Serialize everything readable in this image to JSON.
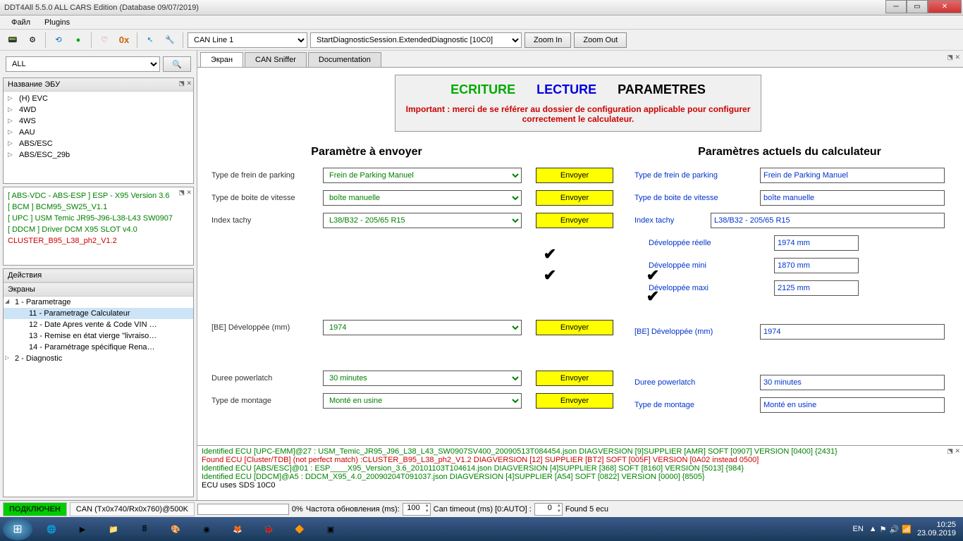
{
  "title": "DDT4All 5.5.0 ALL CARS Edition (Database 09/07/2019)",
  "menu": {
    "file": "Файл",
    "plugins": "Plugins"
  },
  "toolbar": {
    "connection_combo": "CAN Line 1",
    "session_combo": "StartDiagnosticSession.ExtendedDiagnostic [10C0]",
    "zoom_in": "Zoom In",
    "zoom_out": "Zoom Out"
  },
  "left": {
    "filter_all": "ALL",
    "ecu_name_header": "Название ЭБУ",
    "ecu_types": [
      "(H) EVC",
      "4WD",
      "4WS",
      "AAU",
      "ABS/ESC",
      "ABS/ESC_29b"
    ],
    "ecu_detected": [
      "[ ABS-VDC - ABS-ESP ] ESP - X95 Version 3.6",
      "[ BCM ] BCM95_SW25_V1.1",
      "[ UPC ] USM Temic JR95-J96-L38-L43 SW0907",
      "[ DDCM ] Driver DCM X95 SLOT v4.0",
      "CLUSTER_B95_L38_ph2_V1.2"
    ],
    "actions_header": "Действия",
    "screens_header": "Экраны",
    "tree_root": "1 - Parametrage",
    "tree_items": [
      "11 - Parametrage Calculateur",
      "12 - Date Apres vente & Code VIN …",
      "13 - Remise en état vierge \"livraiso…",
      "14 - Paramétrage spécifique Rena…"
    ],
    "tree_diag": "2 - Diagnostic"
  },
  "tabs": {
    "screen": "Экран",
    "sniffer": "CAN Sniffer",
    "docs": "Documentation"
  },
  "header": {
    "ecriture": "ECRITURE",
    "lecture": "LECTURE",
    "parametres": "PARAMETRES",
    "warning": "Important : merci de se référer au dossier de configuration applicable pour configurer correctement le calculateur."
  },
  "params_send_title": "Paramètre à envoyer",
  "params_actual_title": "Paramètres actuels du calculateur",
  "send_btn": "Envoyer",
  "rows": {
    "parking_label": "Type de frein de parking",
    "parking_value": "Frein de Parking Manuel",
    "gearbox_label": "Type de boite de vitesse",
    "gearbox_value": "boîte manuelle",
    "tachy_label": "Index tachy",
    "tachy_value": "L38/B32 - 205/65 R15",
    "dev_reelle_label": "Développée réelle",
    "dev_reelle_value": "1974 mm",
    "dev_mini_label": "Développée mini",
    "dev_mini_value": "1870 mm",
    "dev_maxi_label": "Développée maxi",
    "dev_maxi_value": "2125 mm",
    "be_dev_label": "[BE] Développée (mm)",
    "be_dev_value": "1974",
    "powerlatch_label": "Duree powerlatch",
    "powerlatch_value": "30 minutes",
    "montage_label": "Type de montage",
    "montage_value": "Monté en usine"
  },
  "log": [
    "Identified ECU [UPC-EMM]@27 : USM_Temic_JR95_J96_L38_L43_SW0907SV400_20090513T084454.json DIAGVERSION [9]SUPPLIER [AMR] SOFT [0907] VERSION [0400]  {2431}",
    "Found ECU [Cluster/TDB]  (not perfect match)  :CLUSTER_B95_L38_ph2_V1.2 DIAGVERSION [12] SUPPLIER [BT2] SOFT [005F] VERSION [0A02 instead 0500]",
    "Identified ECU [ABS/ESC]@01 : ESP____X95_Version_3.6_20101103T104614.json DIAGVERSION [4]SUPPLIER [368] SOFT [8160] VERSION [5013]  {984}",
    "Identified ECU [DDCM]@A5 : DDCM_X95_4.0_20090204T091037.json DIAGVERSION [4]SUPPLIER [A54] SOFT [0822] VERSION [0000]  {8505}",
    "ECU uses SDS 10C0"
  ],
  "status": {
    "connected": "ПОДКЛЮЧЕН",
    "can": "CAN (Tx0x740/Rx0x760)@500K",
    "progress": "0%",
    "refresh_label": "Частота обновления (ms):",
    "refresh_value": "100",
    "timeout_label": "Can timeout (ms) [0:AUTO] :",
    "timeout_value": "0",
    "found": "Found 5 ecu"
  },
  "tray": {
    "lang": "EN",
    "time": "10:25",
    "date": "23.09.2019"
  }
}
